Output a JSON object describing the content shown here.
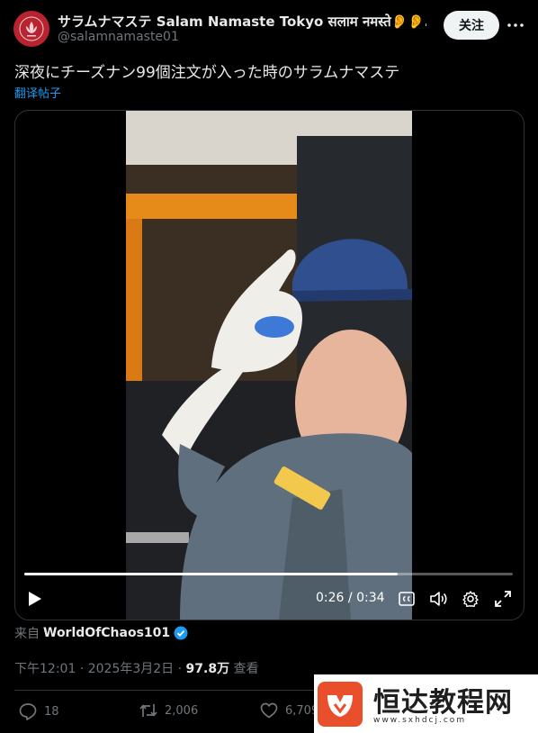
{
  "author": {
    "display_name": "サラムナマステ Salam Namaste Tokyo सलाम नमस्ते👂👂…",
    "handle": "@salamnamaste01"
  },
  "follow_label": "关注",
  "tweet_text": "深夜にチーズナン99個注文が入った時のサラムナマステ",
  "translate_label": "翻译帖子",
  "video": {
    "current_time": "0:26",
    "separator": "/",
    "duration": "0:34",
    "progress_fraction": 0.765
  },
  "source": {
    "prefix": "来自",
    "account": "WorldOfChaos101"
  },
  "meta": {
    "time": "下午12:01",
    "dot": "·",
    "date": "2025年3月2日",
    "views": "97.8万",
    "views_label": "查看"
  },
  "actions": {
    "replies": "18",
    "reposts": "2,006",
    "likes": "6,709"
  },
  "watermark": {
    "title": "恒达教程网",
    "url": "www.sxhdcj.com"
  },
  "colors": {
    "accent": "#1d9bf0",
    "avatar_bg": "#b8232f"
  }
}
